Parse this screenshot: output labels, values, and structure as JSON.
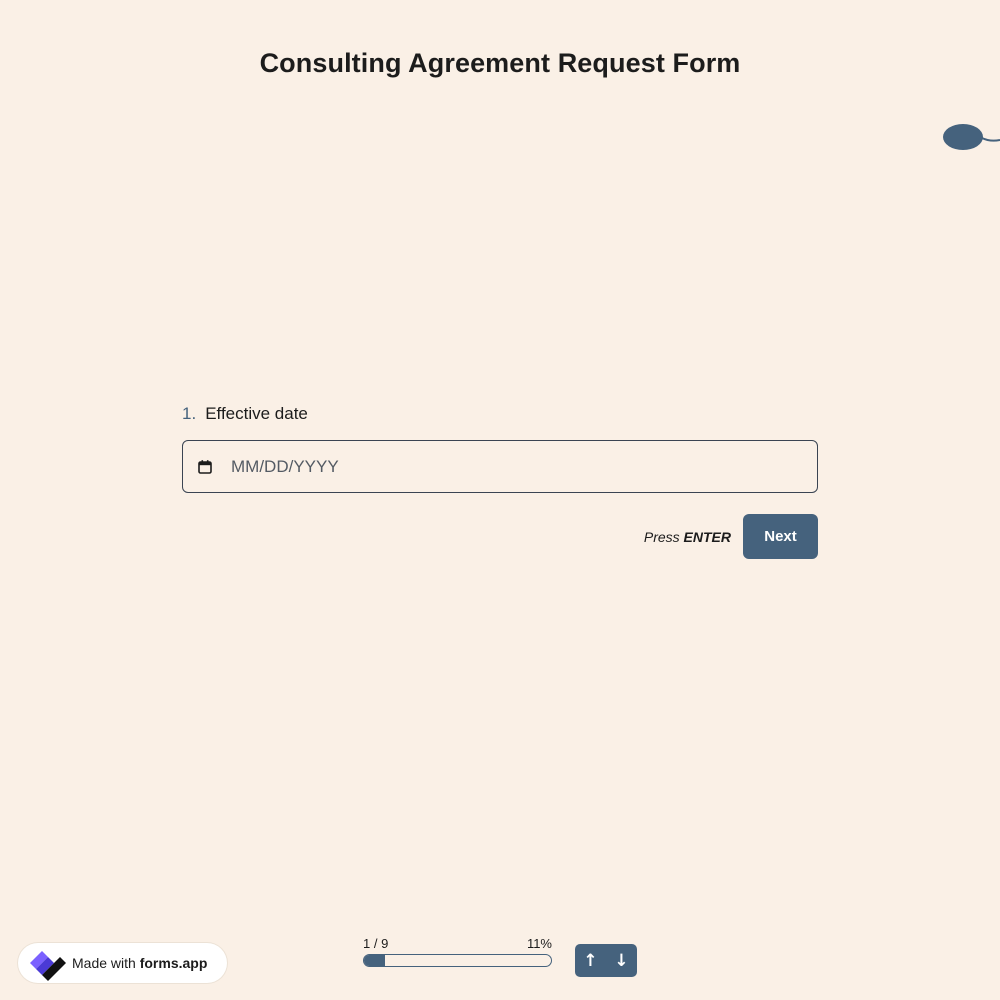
{
  "form": {
    "title": "Consulting Agreement Request Form"
  },
  "question": {
    "number": "1.",
    "label": "Effective date",
    "placeholder": "MM/DD/YYYY",
    "icon": "calendar-icon"
  },
  "actions": {
    "press_prefix": "Press",
    "press_key": "ENTER",
    "next_label": "Next"
  },
  "progress": {
    "counter": "1 / 9",
    "percent_label": "11%",
    "fraction": 0.11
  },
  "badge": {
    "made_with": "Made with",
    "brand": "forms.app",
    "logo": "forms-app-logo"
  },
  "nav": {
    "up": "↑",
    "down": "↓"
  },
  "colors": {
    "background": "#faf0e6",
    "accent": "#45627d",
    "text": "#1c1c1c"
  }
}
